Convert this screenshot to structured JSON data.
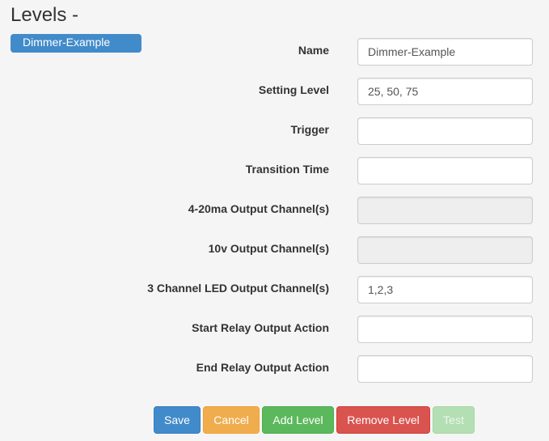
{
  "page": {
    "title": "Levels -"
  },
  "levels": {
    "selected": "Dimmer-Example"
  },
  "form": {
    "fields": [
      {
        "label": "Name",
        "value": "Dimmer-Example",
        "disabled": false
      },
      {
        "label": "Setting Level",
        "value": "25, 50, 75",
        "disabled": false
      },
      {
        "label": "Trigger",
        "value": "",
        "disabled": false
      },
      {
        "label": "Transition Time",
        "value": "",
        "disabled": false
      },
      {
        "label": "4-20ma Output Channel(s)",
        "value": "",
        "disabled": true
      },
      {
        "label": "10v Output Channel(s)",
        "value": "",
        "disabled": true
      },
      {
        "label": "3 Channel LED Output Channel(s)",
        "value": "1,2,3",
        "disabled": false
      },
      {
        "label": "Start Relay Output Action",
        "value": "",
        "disabled": false
      },
      {
        "label": "End Relay Output Action",
        "value": "",
        "disabled": false
      }
    ]
  },
  "buttons": {
    "save": "Save",
    "cancel": "Cancel",
    "add_level": "Add Level",
    "remove_level": "Remove Level",
    "test": "Test"
  },
  "colors": {
    "primary": "#428bca",
    "warning": "#f0ad4e",
    "success": "#5cb85c",
    "danger": "#d9534f",
    "success_disabled": "#b4dfb4",
    "input_disabled_bg": "#eeeeee"
  }
}
